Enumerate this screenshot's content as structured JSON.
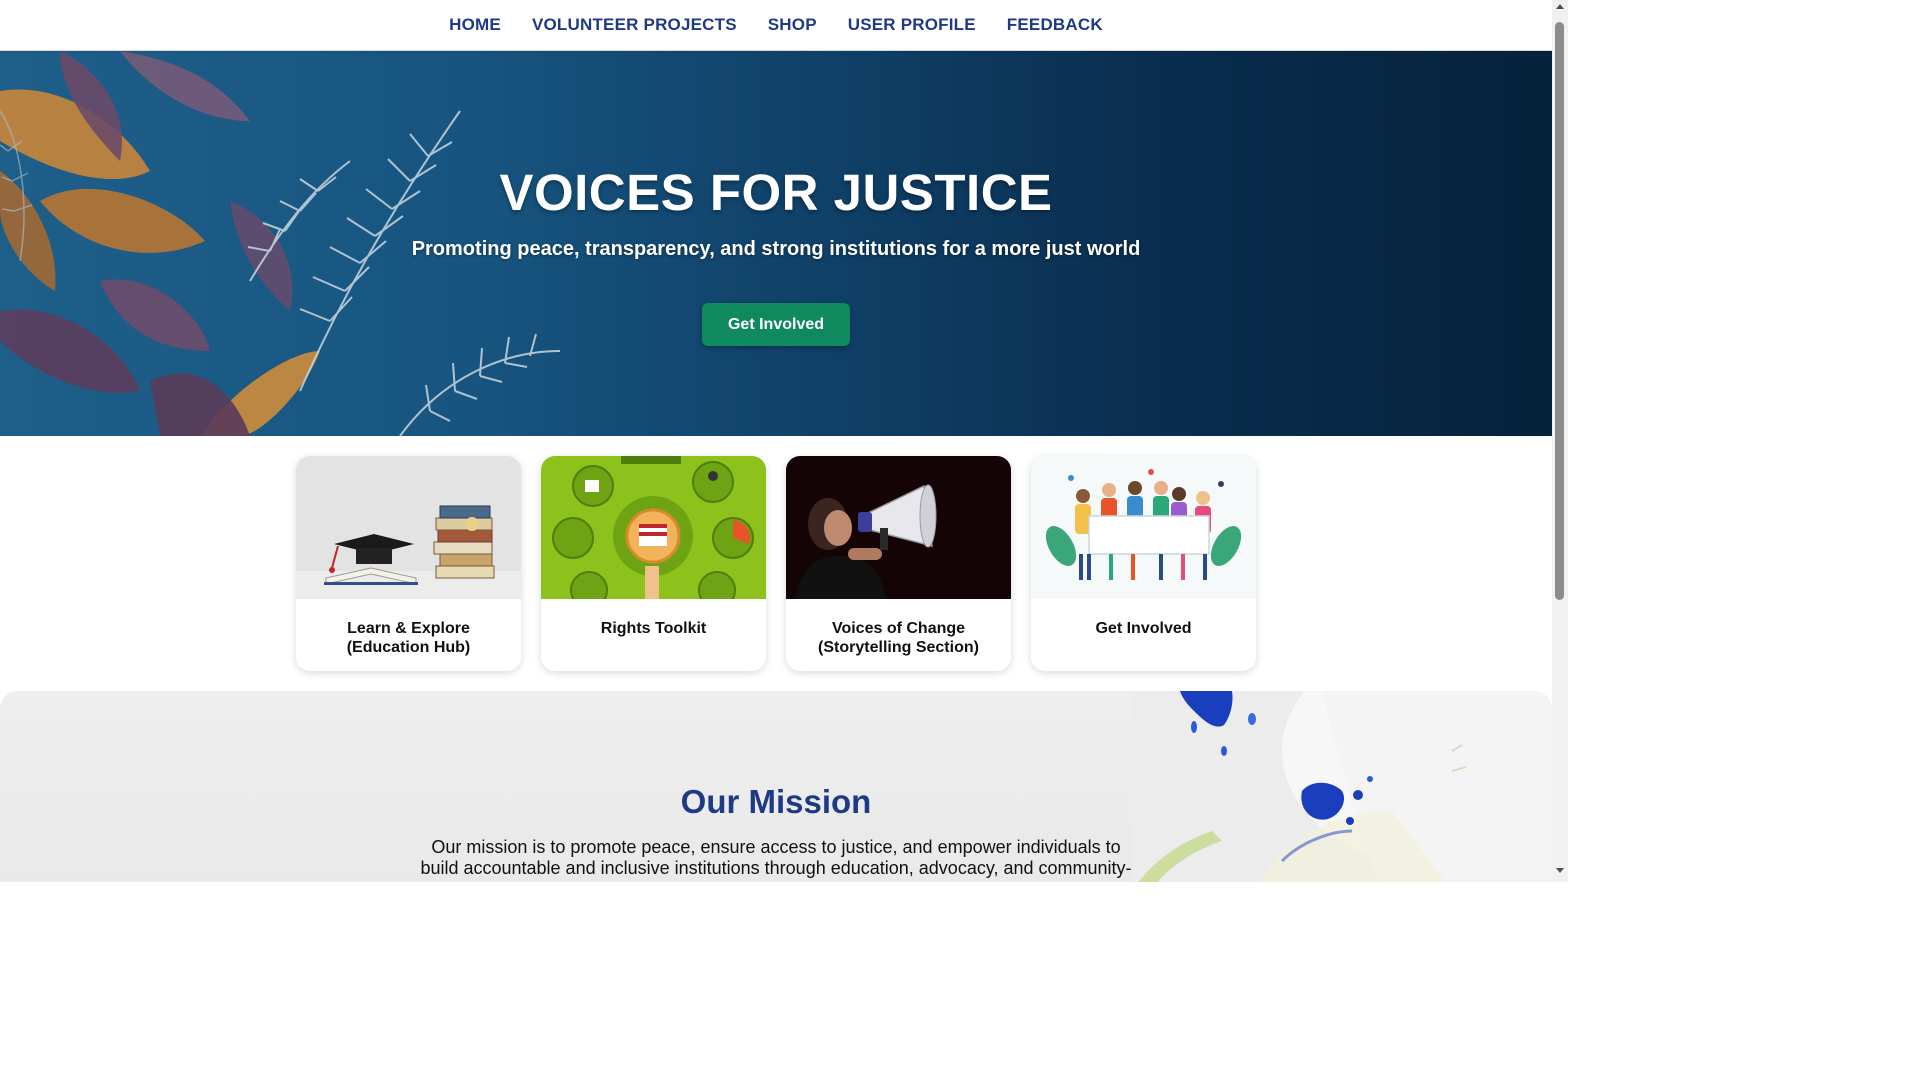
{
  "nav": {
    "items": [
      {
        "label": "HOME"
      },
      {
        "label": "VOLUNTEER PROJECTS"
      },
      {
        "label": "SHOP"
      },
      {
        "label": "USER PROFILE"
      },
      {
        "label": "FEEDBACK"
      }
    ]
  },
  "hero": {
    "title": "VOICES FOR JUSTICE",
    "subtitle": "Promoting peace, transparency, and strong institutions for a more just world",
    "cta_label": "Get Involved"
  },
  "cards": [
    {
      "title": "Learn & Explore (Education Hub)",
      "icon": "graduation-books-image"
    },
    {
      "title": "Rights Toolkit",
      "icon": "rights-infographic-image"
    },
    {
      "title": "Voices of Change (Storytelling Section)",
      "icon": "megaphone-image"
    },
    {
      "title": "Get Involved",
      "icon": "crowd-banner-image"
    }
  ],
  "mission": {
    "title": "Our Mission",
    "text": "Our mission is to promote peace, ensure access to justice, and empower individuals to build accountable and inclusive institutions through education, advocacy, and community-"
  },
  "colors": {
    "nav_text": "#1f3a85",
    "hero_dark": "#06223b",
    "hero_light": "#1e5f8a",
    "cta_green": "#0f8a5f",
    "mission_title": "#1f3a85"
  }
}
